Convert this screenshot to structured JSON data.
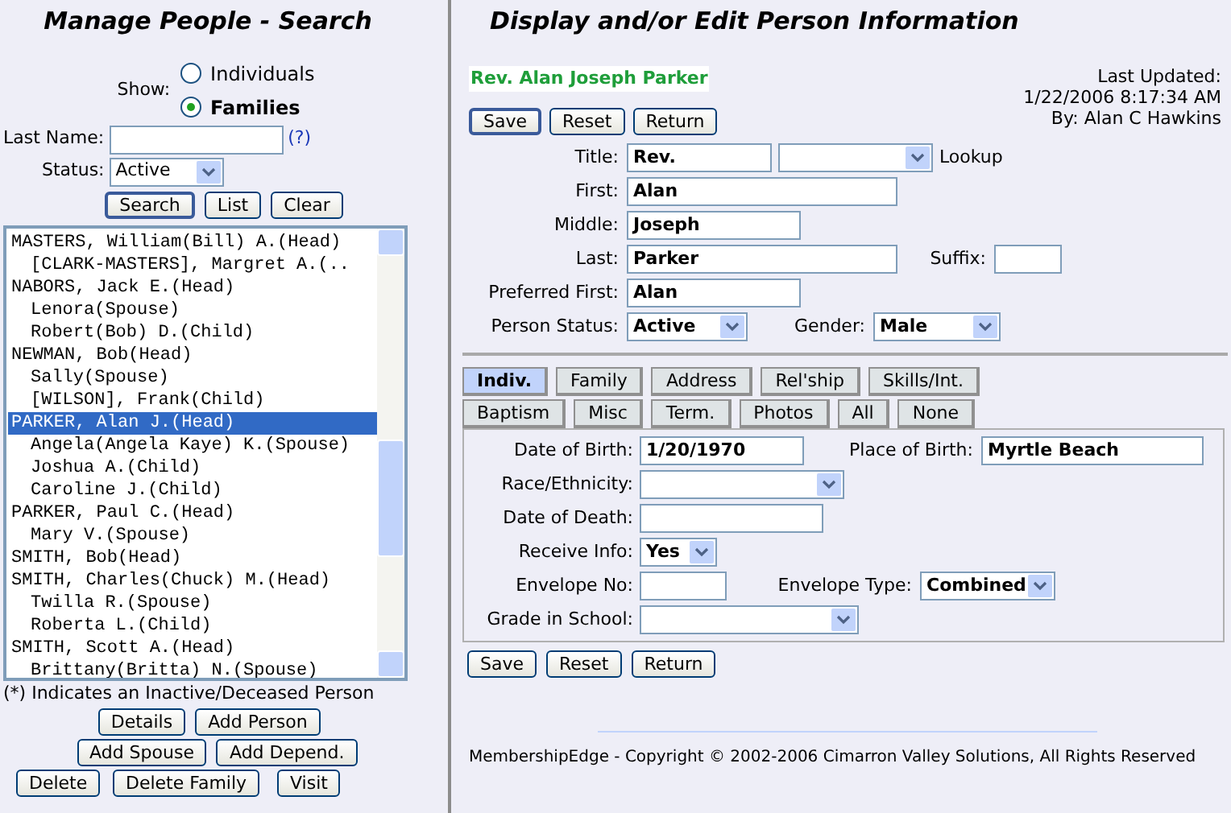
{
  "left": {
    "title": "Manage People - Search",
    "show": {
      "label": "Show:",
      "options": [
        {
          "label": "Individuals",
          "selected": false
        },
        {
          "label": "Families",
          "selected": true
        }
      ]
    },
    "last_name": {
      "label": "Last Name:",
      "help": "(?)"
    },
    "status": {
      "label": "Status:",
      "value": "Active"
    },
    "search_buttons": [
      "Search",
      "List",
      "Clear"
    ],
    "people": [
      {
        "text": "MASTERS, William(Bill) A.(Head)",
        "selected": false,
        "children": [
          {
            "text": "[CLARK-MASTERS], Margret A.(..",
            "selected": false
          }
        ]
      },
      {
        "text": "NABORS, Jack E.(Head)",
        "selected": false,
        "children": [
          {
            "text": "Lenora(Spouse)",
            "selected": false
          },
          {
            "text": "Robert(Bob) D.(Child)",
            "selected": false
          }
        ]
      },
      {
        "text": "NEWMAN, Bob(Head)",
        "selected": false,
        "children": [
          {
            "text": "Sally(Spouse)",
            "selected": false
          },
          {
            "text": "[WILSON], Frank(Child)",
            "selected": false
          }
        ]
      },
      {
        "text": "PARKER, Alan J.(Head)",
        "selected": true,
        "children": [
          {
            "text": "Angela(Angela Kaye) K.(Spouse)",
            "selected": false
          },
          {
            "text": "Joshua A.(Child)",
            "selected": false
          },
          {
            "text": "Caroline J.(Child)",
            "selected": false
          }
        ]
      },
      {
        "text": "PARKER, Paul C.(Head)",
        "selected": false,
        "children": [
          {
            "text": "Mary V.(Spouse)",
            "selected": false
          }
        ]
      },
      {
        "text": "SMITH, Bob(Head)",
        "selected": false
      },
      {
        "text": "SMITH, Charles(Chuck) M.(Head)",
        "selected": false,
        "children": [
          {
            "text": "Twilla R.(Spouse)",
            "selected": false
          },
          {
            "text": "Roberta L.(Child)",
            "selected": false
          }
        ]
      },
      {
        "text": "SMITH, Scott A.(Head)",
        "selected": false,
        "children": [
          {
            "text": "Brittany(Britta) N.(Spouse)",
            "selected": false
          }
        ]
      }
    ],
    "note": "(*) Indicates an Inactive/Deceased Person",
    "action_rows": [
      [
        "Details",
        "Add Person"
      ],
      [
        "Add Spouse",
        "Add Depend."
      ],
      [
        "Delete",
        "Delete Family",
        "Visit"
      ]
    ]
  },
  "right": {
    "title": "Display and/or Edit Person Information",
    "person_name": "Rev. Alan Joseph Parker",
    "last_updated": [
      "Last Updated:",
      "1/22/2006 8:17:34 AM",
      "By: Alan C Hawkins"
    ],
    "buttons": [
      "Save",
      "Reset",
      "Return"
    ],
    "person_form": {
      "title": {
        "label": "Title:",
        "value": "Rev."
      },
      "lookup": {
        "label": "Lookup"
      },
      "first": {
        "label": "First:",
        "value": "Alan"
      },
      "middle": {
        "label": "Middle:",
        "value": "Joseph"
      },
      "last": {
        "label": "Last:",
        "value": "Parker"
      },
      "suffix": {
        "label": "Suffix:"
      },
      "preferred_first": {
        "label": "Preferred First:",
        "value": "Alan"
      },
      "person_status": {
        "label": "Person Status:",
        "value": "Active"
      },
      "gender": {
        "label": "Gender:",
        "value": "Male"
      }
    },
    "tab_rows": [
      [
        {
          "label": "Indiv.",
          "selected": true
        },
        {
          "label": "Family",
          "selected": false
        },
        {
          "label": "Address",
          "selected": false
        },
        {
          "label": "Rel'ship",
          "selected": false
        },
        {
          "label": "Skills/Int.",
          "selected": false
        }
      ],
      [
        {
          "label": "Baptism",
          "selected": false
        },
        {
          "label": "Misc",
          "selected": false
        },
        {
          "label": "Term.",
          "selected": false
        },
        {
          "label": "Photos",
          "selected": false
        },
        {
          "label": "All",
          "selected": false
        },
        {
          "label": "None",
          "selected": false
        }
      ]
    ],
    "details": {
      "date_of_birth": {
        "label": "Date of Birth:",
        "value": "1/20/1970"
      },
      "place_of_birth": {
        "label": "Place of Birth:",
        "value": "Myrtle Beach"
      },
      "race": {
        "label": "Race/Ethnicity:"
      },
      "date_of_death": {
        "label": "Date of Death:"
      },
      "receive_info": {
        "label": "Receive Info:",
        "value": "Yes"
      },
      "envelope_no": {
        "label": "Envelope No:"
      },
      "envelope_type": {
        "label": "Envelope Type:",
        "value": "Combined"
      },
      "grade": {
        "label": "Grade in School:"
      }
    },
    "bottom_buttons": [
      "Save",
      "Reset",
      "Return"
    ],
    "footer": "MembershipEdge - Copyright © 2002-2006 Cimarron Valley Solutions, All Rights Reserved"
  }
}
